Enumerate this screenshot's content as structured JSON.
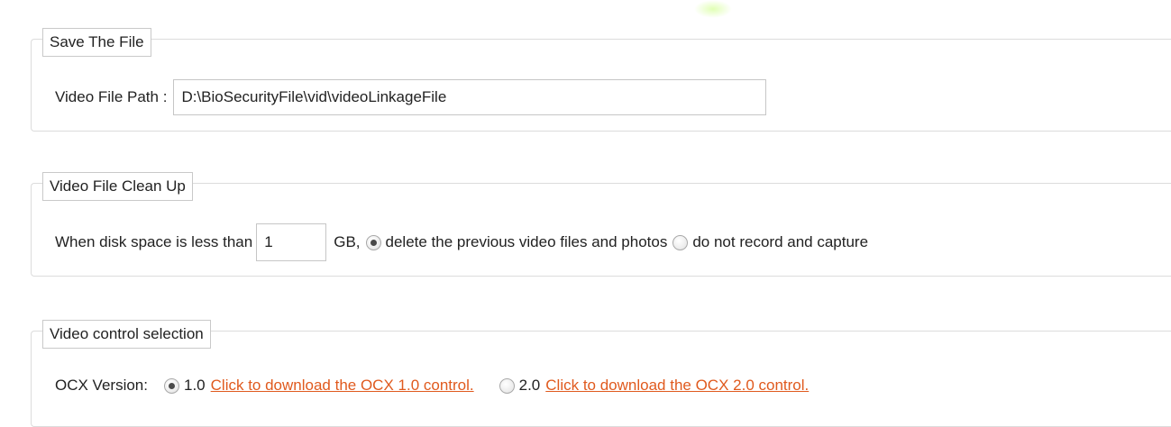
{
  "save_file": {
    "legend": "Save The File",
    "path_label": "Video File Path :",
    "path_value": "D:\\BioSecurityFile\\vid\\videoLinkageFile"
  },
  "clean_up": {
    "legend": "Video File Clean Up",
    "prefix_text": "When disk space is less than",
    "disk_value": "1",
    "unit_text": "GB,",
    "option_delete": "delete the previous video files and photos",
    "option_delete_checked": true,
    "option_no_record": "do not record and capture",
    "option_no_record_checked": false
  },
  "video_control": {
    "legend": "Video control selection",
    "ocx_label": "OCX Version:",
    "ocx1_version": "1.0",
    "ocx1_link": "Click to download the OCX 1.0 control.",
    "ocx1_checked": true,
    "ocx2_version": "2.0",
    "ocx2_link": "Click to download the OCX 2.0 control.",
    "ocx2_checked": false
  },
  "colors": {
    "link": "#e05a1e",
    "border": "#dcdcdc"
  }
}
